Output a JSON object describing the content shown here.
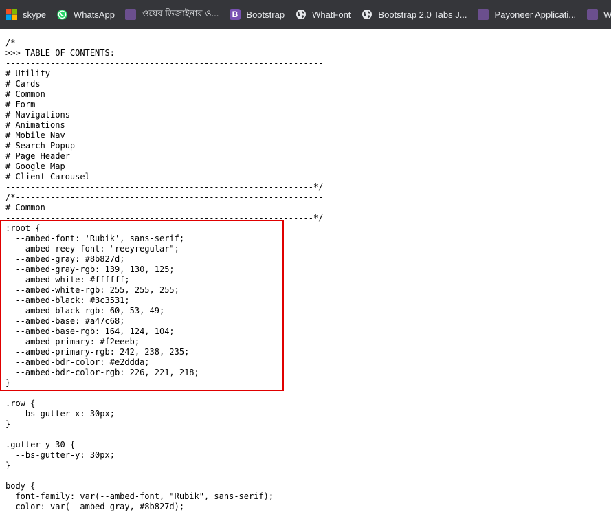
{
  "bookmarks": [
    {
      "label": "skype",
      "icon": "microsoft-windows-icon"
    },
    {
      "label": "WhatsApp",
      "icon": "whatsapp-icon"
    },
    {
      "label": "ওয়েব ডিজাইনার ও...",
      "icon": "bookmark-tile-icon"
    },
    {
      "label": "Bootstrap",
      "icon": "bootstrap-icon",
      "icon_text": "B"
    },
    {
      "label": "WhatFont",
      "icon": "globe-icon"
    },
    {
      "label": "Bootstrap 2.0 Tabs J...",
      "icon": "globe-icon"
    },
    {
      "label": "Payoneer Applicati...",
      "icon": "bookmark-tile-icon"
    },
    {
      "label": "Web Design",
      "icon": "bookmark-tile-icon"
    }
  ],
  "code_lines": [
    "/*--------------------------------------------------------------",
    ">>> TABLE OF CONTENTS:",
    "----------------------------------------------------------------",
    "# Utility",
    "# Cards",
    "# Common",
    "# Form",
    "# Navigations",
    "# Animations",
    "# Mobile Nav",
    "# Search Popup",
    "# Page Header",
    "# Google Map",
    "# Client Carousel",
    "--------------------------------------------------------------*/",
    "/*--------------------------------------------------------------",
    "# Common",
    "--------------------------------------------------------------*/",
    ":root {",
    "  --ambed-font: 'Rubik', sans-serif;",
    "  --ambed-reey-font: \"reeyregular\";",
    "  --ambed-gray: #8b827d;",
    "  --ambed-gray-rgb: 139, 130, 125;",
    "  --ambed-white: #ffffff;",
    "  --ambed-white-rgb: 255, 255, 255;",
    "  --ambed-black: #3c3531;",
    "  --ambed-black-rgb: 60, 53, 49;",
    "  --ambed-base: #a47c68;",
    "  --ambed-base-rgb: 164, 124, 104;",
    "  --ambed-primary: #f2eeeb;",
    "  --ambed-primary-rgb: 242, 238, 235;",
    "  --ambed-bdr-color: #e2ddda;",
    "  --ambed-bdr-color-rgb: 226, 221, 218;",
    "}",
    "",
    ".row {",
    "  --bs-gutter-x: 30px;",
    "}",
    "",
    ".gutter-y-30 {",
    "  --bs-gutter-y: 30px;",
    "}",
    "",
    "body {",
    "  font-family: var(--ambed-font, \"Rubik\", sans-serif);",
    "  color: var(--ambed-gray, #8b827d);"
  ],
  "colors": {
    "bookmarks_bar_bg": "#35363a",
    "bookmark_text": "#e8eaed",
    "page_bg": "#ffffff",
    "code_text": "#000000",
    "highlight_border": "#e00000"
  }
}
